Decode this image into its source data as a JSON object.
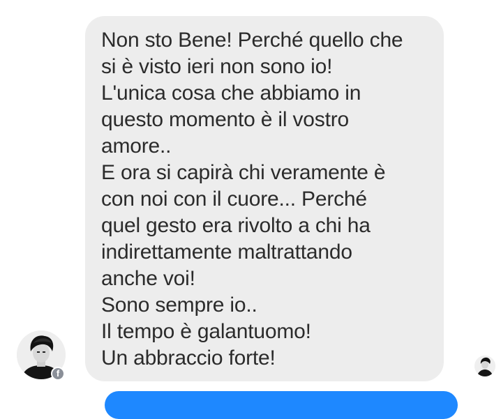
{
  "conversation": {
    "header_fragment": "",
    "incoming_message": {
      "lines": [
        "Non sto Bene! Perché quello che",
        "si è visto ieri non sono io!",
        "L'unica cosa che abbiamo in",
        "questo momento è il vostro",
        "amore..",
        "E ora si capirà chi veramente è",
        "con noi con il cuore... Perché",
        "quel gesto era rivolto a chi ha",
        "indirettamente maltrattando",
        "anche voi!",
        "Sono sempre io..",
        "Il tempo è galantuomo!",
        "Un abbraccio forte!"
      ]
    },
    "sender_avatar": {
      "icon": "user-avatar-icon",
      "badge_icon": "facebook-icon",
      "badge_glyph": "f"
    },
    "read_receipt": {
      "icon": "read-receipt-avatar-icon"
    },
    "outgoing_bubble_color": "#1e88ff",
    "incoming_bubble_color": "#ededed"
  }
}
